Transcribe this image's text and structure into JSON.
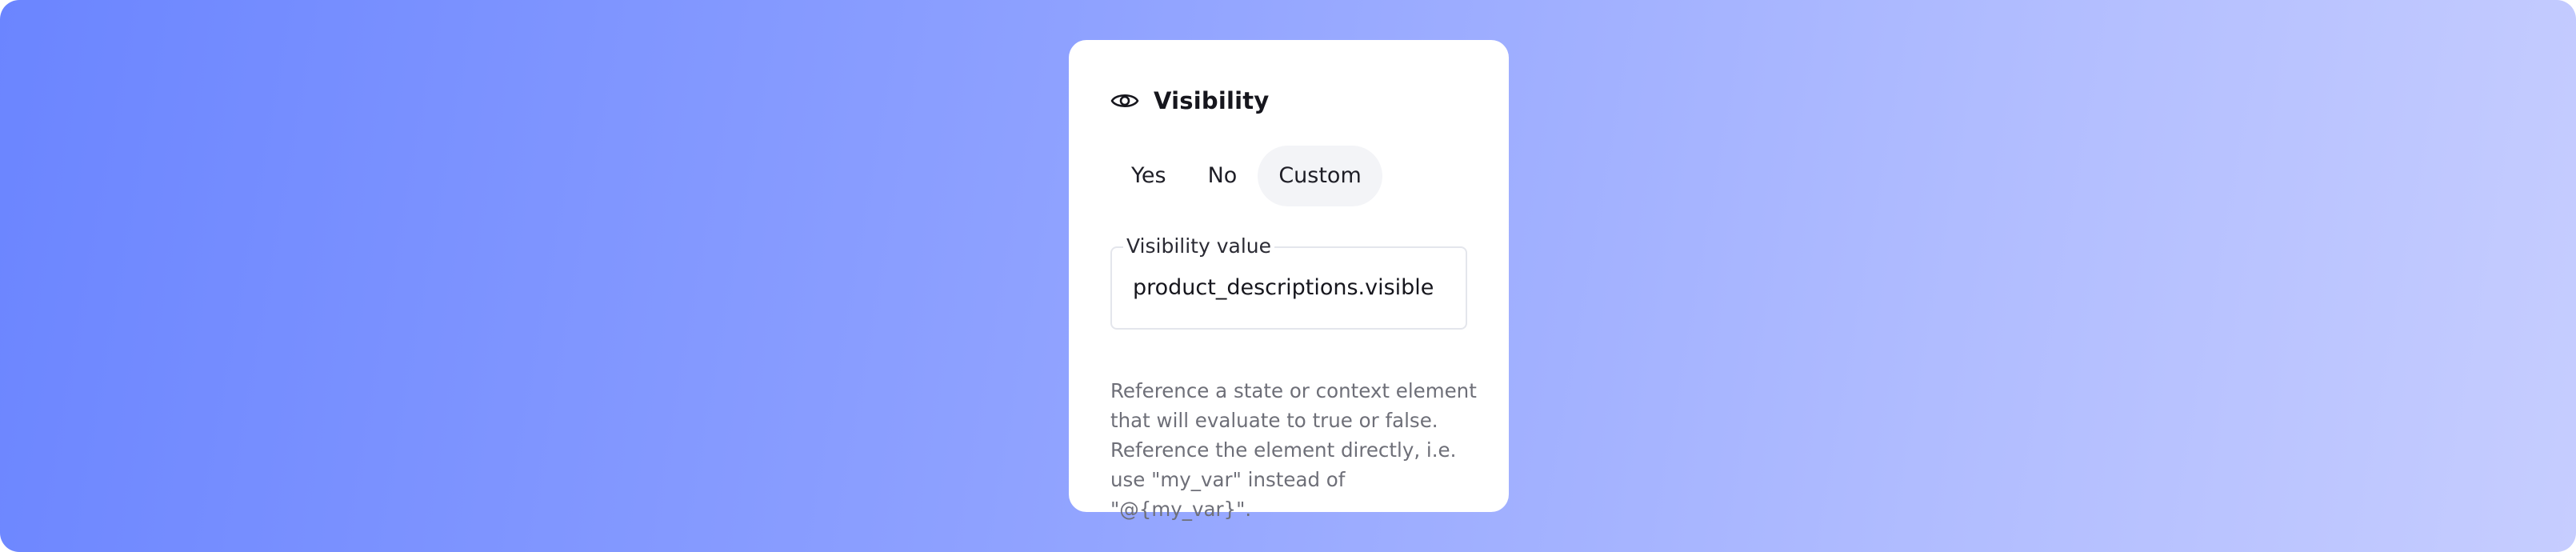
{
  "panel": {
    "title": "Visibility",
    "title_icon": "eye-icon"
  },
  "segmented": {
    "options": [
      {
        "label": "Yes",
        "selected": false
      },
      {
        "label": "No",
        "selected": false
      },
      {
        "label": "Custom",
        "selected": true
      }
    ]
  },
  "visibility_field": {
    "label": "Visibility value",
    "value": "product_descriptions.visible"
  },
  "help_text": "Reference a state or context element that will evaluate to true or false. Reference the element directly, i.e. use \"my_var\" instead of \"@{my_var}\".",
  "colors": {
    "background_start": "#6b85ff",
    "background_end": "#c6cdff",
    "card": "#ffffff",
    "selected_pill": "#f3f4f7",
    "help_text": "#6e6f78"
  }
}
